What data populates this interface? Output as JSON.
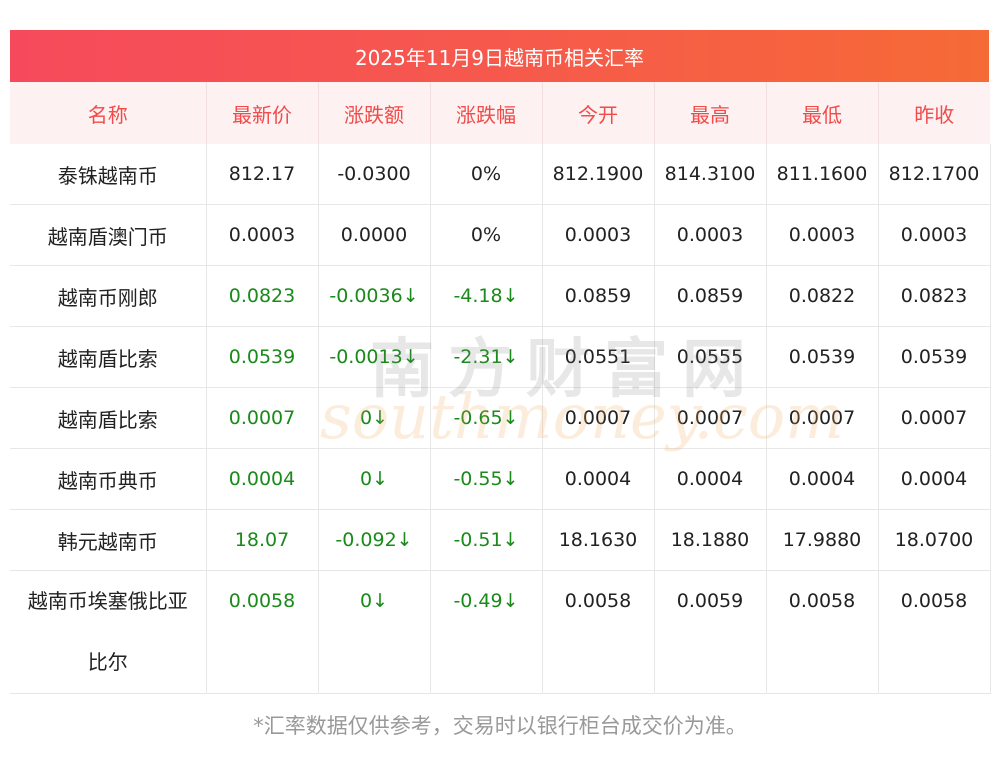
{
  "title": "2025年11月9日越南币相关汇率",
  "headers": [
    "名称",
    "最新价",
    "涨跌额",
    "涨跌幅",
    "今开",
    "最高",
    "最低",
    "昨收"
  ],
  "rows": [
    {
      "name": "泰铢越南币",
      "latest": "812.17",
      "change": "-0.0300",
      "pct": "0%",
      "open": "812.1900",
      "high": "814.3100",
      "low": "811.1600",
      "prev": "812.1700",
      "trend": "flat"
    },
    {
      "name": "越南盾澳门币",
      "latest": "0.0003",
      "change": "0.0000",
      "pct": "0%",
      "open": "0.0003",
      "high": "0.0003",
      "low": "0.0003",
      "prev": "0.0003",
      "trend": "flat"
    },
    {
      "name": "越南币刚郎",
      "latest": "0.0823",
      "change": "-0.0036↓",
      "pct": "-4.18↓",
      "open": "0.0859",
      "high": "0.0859",
      "low": "0.0822",
      "prev": "0.0823",
      "trend": "down"
    },
    {
      "name": "越南盾比索",
      "latest": "0.0539",
      "change": "-0.0013↓",
      "pct": "-2.31↓",
      "open": "0.0551",
      "high": "0.0555",
      "low": "0.0539",
      "prev": "0.0539",
      "trend": "down"
    },
    {
      "name": "越南盾比索",
      "latest": "0.0007",
      "change": "0↓",
      "pct": "-0.65↓",
      "open": "0.0007",
      "high": "0.0007",
      "low": "0.0007",
      "prev": "0.0007",
      "trend": "down"
    },
    {
      "name": "越南币典币",
      "latest": "0.0004",
      "change": "0↓",
      "pct": "-0.55↓",
      "open": "0.0004",
      "high": "0.0004",
      "low": "0.0004",
      "prev": "0.0004",
      "trend": "down"
    },
    {
      "name": "韩元越南币",
      "latest": "18.07",
      "change": "-0.092↓",
      "pct": "-0.51↓",
      "open": "18.1630",
      "high": "18.1880",
      "low": "17.9880",
      "prev": "18.0700",
      "trend": "down"
    },
    {
      "name_line1": "越南币埃塞俄比亚",
      "name_line2": "比尔",
      "latest": "0.0058",
      "change": "0↓",
      "pct": "-0.49↓",
      "open": "0.0058",
      "high": "0.0059",
      "low": "0.0058",
      "prev": "0.0058",
      "trend": "down"
    }
  ],
  "footnote": "*汇率数据仅供参考，交易时以银行柜台成交价为准。",
  "watermark": {
    "cn": "南方财富网",
    "en": "southmoney.com"
  },
  "colors": {
    "header_bg_start": "#f64a5c",
    "header_bg_end": "#f66a36",
    "header_text": "#f14b4b",
    "down": "#1a8a1a"
  }
}
